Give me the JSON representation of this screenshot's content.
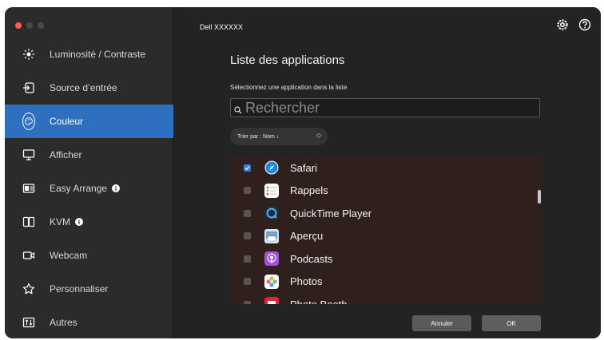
{
  "window": {
    "model": "Dell XXXXXX"
  },
  "sidebar": {
    "items": [
      {
        "label": "Luminosité / Contraste",
        "icon": "brightness-icon",
        "active": false,
        "info": false
      },
      {
        "label": "Source d’entrée",
        "icon": "input-source-icon",
        "active": false,
        "info": false
      },
      {
        "label": "Couleur",
        "icon": "color-palette-icon",
        "active": true,
        "info": false
      },
      {
        "label": "Afficher",
        "icon": "display-icon",
        "active": false,
        "info": false
      },
      {
        "label": "Easy Arrange",
        "icon": "easy-arrange-icon",
        "active": false,
        "info": true
      },
      {
        "label": "KVM",
        "icon": "kvm-icon",
        "active": false,
        "info": true
      },
      {
        "label": "Webcam",
        "icon": "webcam-icon",
        "active": false,
        "info": false
      },
      {
        "label": "Personnaliser",
        "icon": "star-icon",
        "active": false,
        "info": false
      },
      {
        "label": "Autres",
        "icon": "others-icon",
        "active": false,
        "info": false
      }
    ]
  },
  "main": {
    "title": "Liste des applications",
    "subtitle": "Sélectionnez une application dans la liste",
    "search_placeholder": "Rechercher",
    "sort_label": "Trier par : Nom ↓",
    "apps": [
      {
        "name": "Safari",
        "checked": true,
        "icon": "safari-icon",
        "color": "#1e88e5"
      },
      {
        "name": "Rappels",
        "checked": false,
        "icon": "reminders-icon",
        "color": "#ffffff"
      },
      {
        "name": "QuickTime Player",
        "checked": false,
        "icon": "quicktime-icon",
        "color": "#2a3a4a"
      },
      {
        "name": "Aperçu",
        "checked": false,
        "icon": "preview-icon",
        "color": "#6fa3d8"
      },
      {
        "name": "Podcasts",
        "checked": false,
        "icon": "podcasts-icon",
        "color": "#a34ee0"
      },
      {
        "name": "Photos",
        "checked": false,
        "icon": "photos-icon",
        "color": "#f2b33d"
      },
      {
        "name": "Photo Booth",
        "checked": false,
        "icon": "photo-booth-icon",
        "color": "#d8263a"
      }
    ],
    "cancel_label": "Annuler",
    "ok_label": "OK"
  },
  "colors": {
    "accent": "#2e6fbf",
    "list_bg": "#2f201e",
    "checkbox_checked": "#2f7fe8"
  }
}
